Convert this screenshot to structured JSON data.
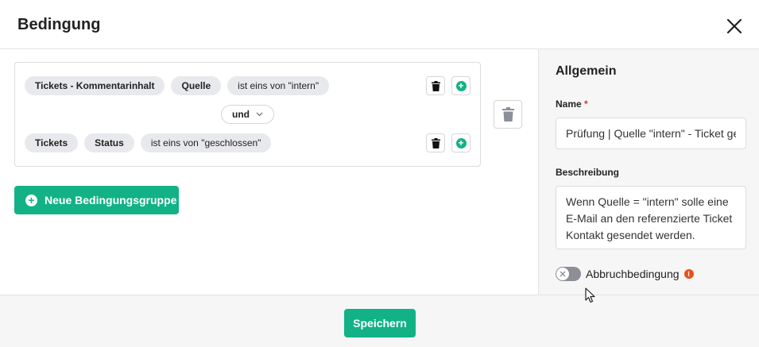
{
  "dialog": {
    "title": "Bedingung",
    "close_icon": "close-icon"
  },
  "conditions": {
    "rows": [
      {
        "object": "Tickets - Kommentarinhalt",
        "field": "Quelle",
        "operator_value": "ist eins von \"intern\""
      },
      {
        "object": "Tickets",
        "field": "Status",
        "operator_value": "ist eins von \"geschlossen\""
      }
    ],
    "connector": "und",
    "new_group_label": "Neue Bedingungsgruppe"
  },
  "sidebar": {
    "section_title": "Allgemein",
    "name_label": "Name",
    "required_mark": "*",
    "name_value": "Prüfung | Quelle \"intern\" - Ticket geschlossen",
    "description_label": "Beschreibung",
    "description_value": "Wenn Quelle = \"intern\" solle eine E-Mail an den referenzierte Ticket Kontakt gesendet werden.",
    "abort_label": "Abbruchbedingung",
    "abort_enabled": false,
    "info_mark": "i"
  },
  "footer": {
    "save_label": "Speichern"
  },
  "colors": {
    "accent": "#12b286",
    "chip_bg": "#e8e9ec",
    "required": "#e0342b",
    "info": "#e8501d",
    "toggle_off": "#8d8f96"
  }
}
